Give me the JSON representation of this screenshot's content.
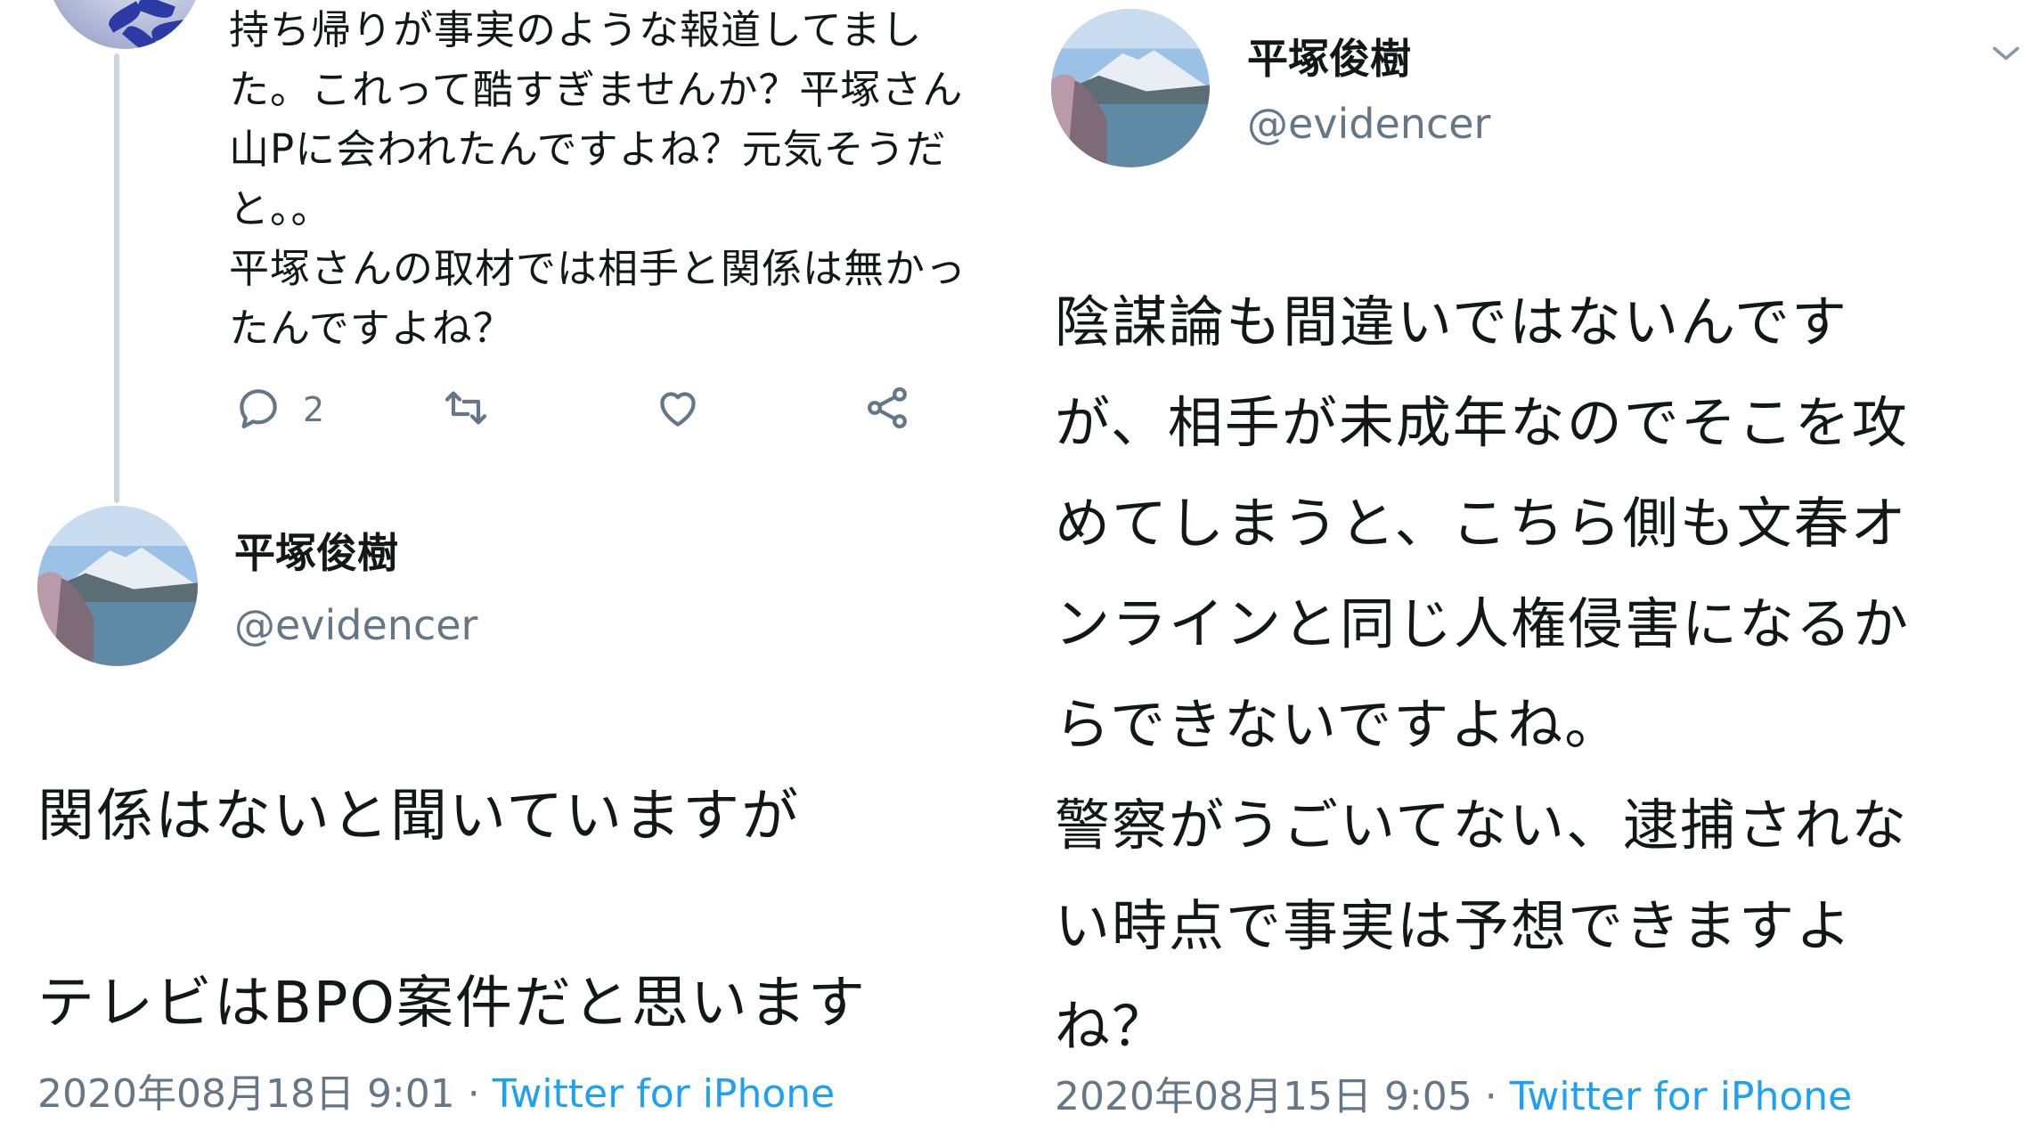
{
  "left": {
    "reply": {
      "text": "持ち帰りが事実のような報道してまし\nた。これって酷すぎませんか？平塚さん\n山Pに会われたんですよね？元気そうだ\nと。。\n平塚さんの取材では相手と関係は無かっ\nたんですよね？",
      "actions": {
        "reply_count": "2",
        "reply_icon": "reply-icon",
        "retweet_icon": "retweet-icon",
        "like_icon": "heart-icon",
        "share_icon": "share-icon"
      }
    },
    "tweet": {
      "name": "平塚俊樹",
      "handle": "@evidencer",
      "body_line1": "関係はないと聞いていますが",
      "body_line2": "テレビはBPO案件だと思います",
      "timestamp": "2020年08月18日 9:01",
      "separator": "·",
      "source": "Twitter for iPhone"
    }
  },
  "right": {
    "tweet": {
      "name": "平塚俊樹",
      "handle": "@evidencer",
      "body": "陰謀論も間違いではないんです\nが、相手が未成年なのでそこを攻\nめてしまうと、こちら側も文春オ\nンラインと同じ人権侵害になるか\nらできないですよね。\n警察がうごいてない、逮捕されな\nい時点で事実は予想できますよ\nね？",
      "timestamp": "2020年08月15日 9:05",
      "separator": "·",
      "source": "Twitter for iPhone",
      "menu_icon": "chevron-down-icon"
    }
  },
  "colors": {
    "text": "#14171a",
    "secondary": "#657786",
    "link": "#1da1f2",
    "thread_line": "#ccd6dd"
  }
}
